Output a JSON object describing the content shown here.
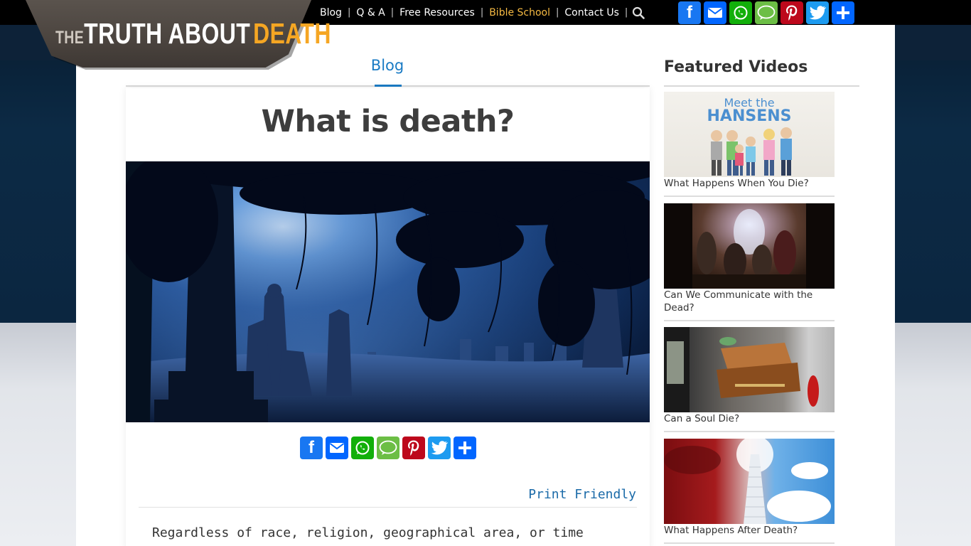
{
  "site": {
    "logo": {
      "the": "THE",
      "truth_about": "TRUTH ABOUT",
      "death": "DEATH"
    }
  },
  "nav": {
    "items": [
      {
        "label": "Blog",
        "active": false
      },
      {
        "label": "Q & A",
        "active": false
      },
      {
        "label": "Free Resources",
        "active": false
      },
      {
        "label": "Bible School",
        "active": true
      },
      {
        "label": "Contact Us",
        "active": false
      }
    ],
    "separator": "|"
  },
  "share": {
    "facebook": "f",
    "sms": "SMS"
  },
  "main": {
    "tab_label": "Blog",
    "post_title": "What is death?",
    "print_label": "Print Friendly",
    "body_first_line": "Regardless of race, religion, geographical area, or time"
  },
  "sidebar": {
    "title": "Featured Videos",
    "videos": [
      {
        "caption": "What Happens When You Die?",
        "thumb_text_1": "Meet the",
        "thumb_text_2": "HANSENS"
      },
      {
        "caption": "Can We Communicate with the Dead?"
      },
      {
        "caption": "Can a Soul Die?"
      },
      {
        "caption": "What Happens After Death?"
      }
    ]
  },
  "colors": {
    "accent_blue": "#1a7bc4",
    "nav_active": "#f5b942",
    "logo_orange": "#f5a623"
  }
}
